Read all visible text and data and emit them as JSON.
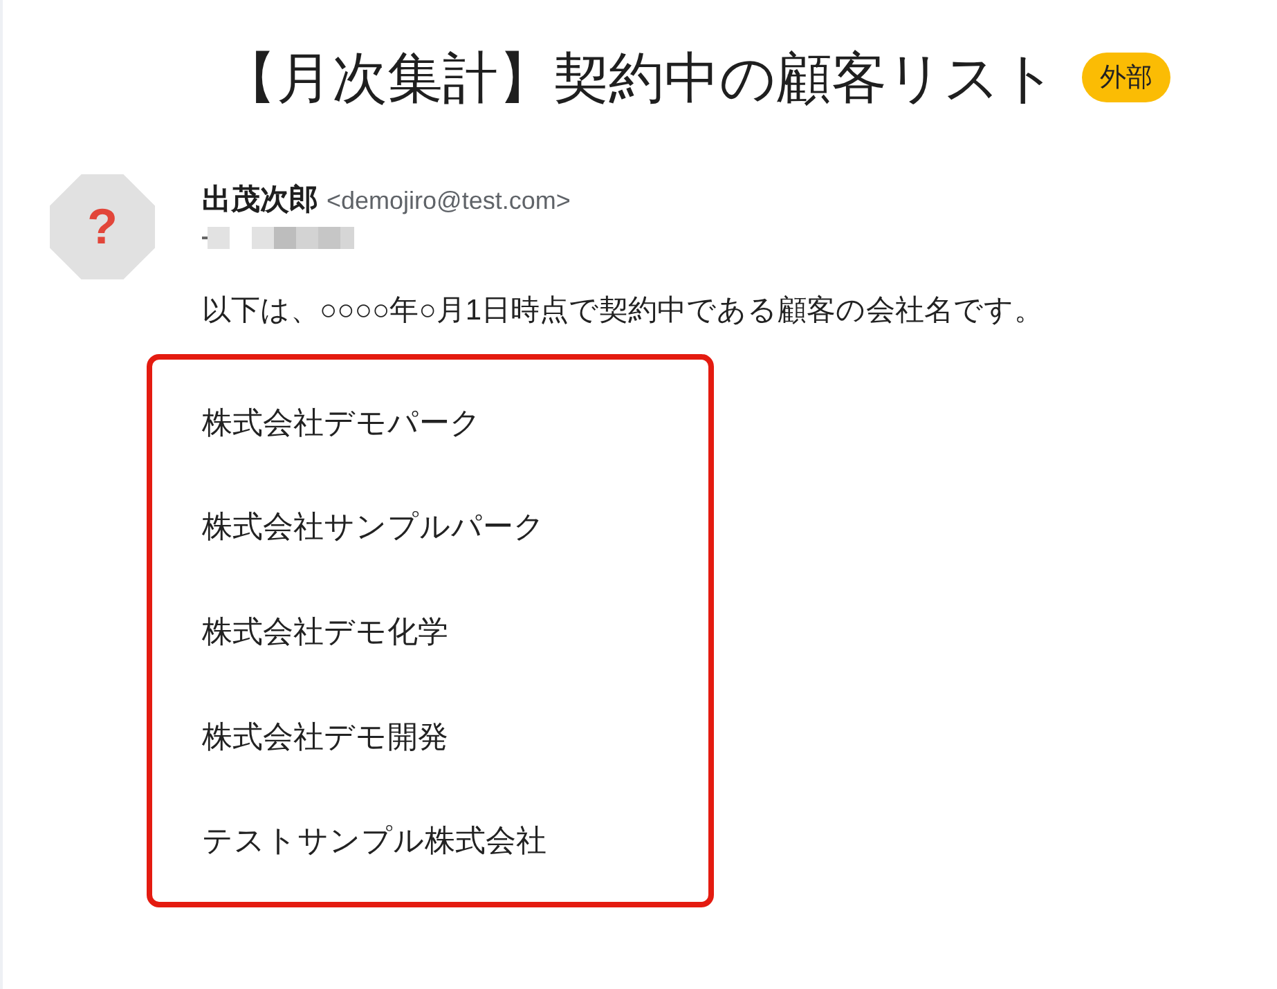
{
  "subject": {
    "title": "【月次集計】契約中の顧客リスト",
    "badge": "外部"
  },
  "message": {
    "avatar": "?",
    "sender_name": "出茂次郎",
    "sender_email": "<demojiro@test.com>",
    "body": "以下は、○○○○年○月1日時点で契約中である顧客の会社名です。",
    "companies": [
      "株式会社デモパーク",
      "株式会社サンプルパーク",
      "株式会社デモ化学",
      "株式会社デモ開発",
      "テストサンプル株式会社"
    ]
  }
}
